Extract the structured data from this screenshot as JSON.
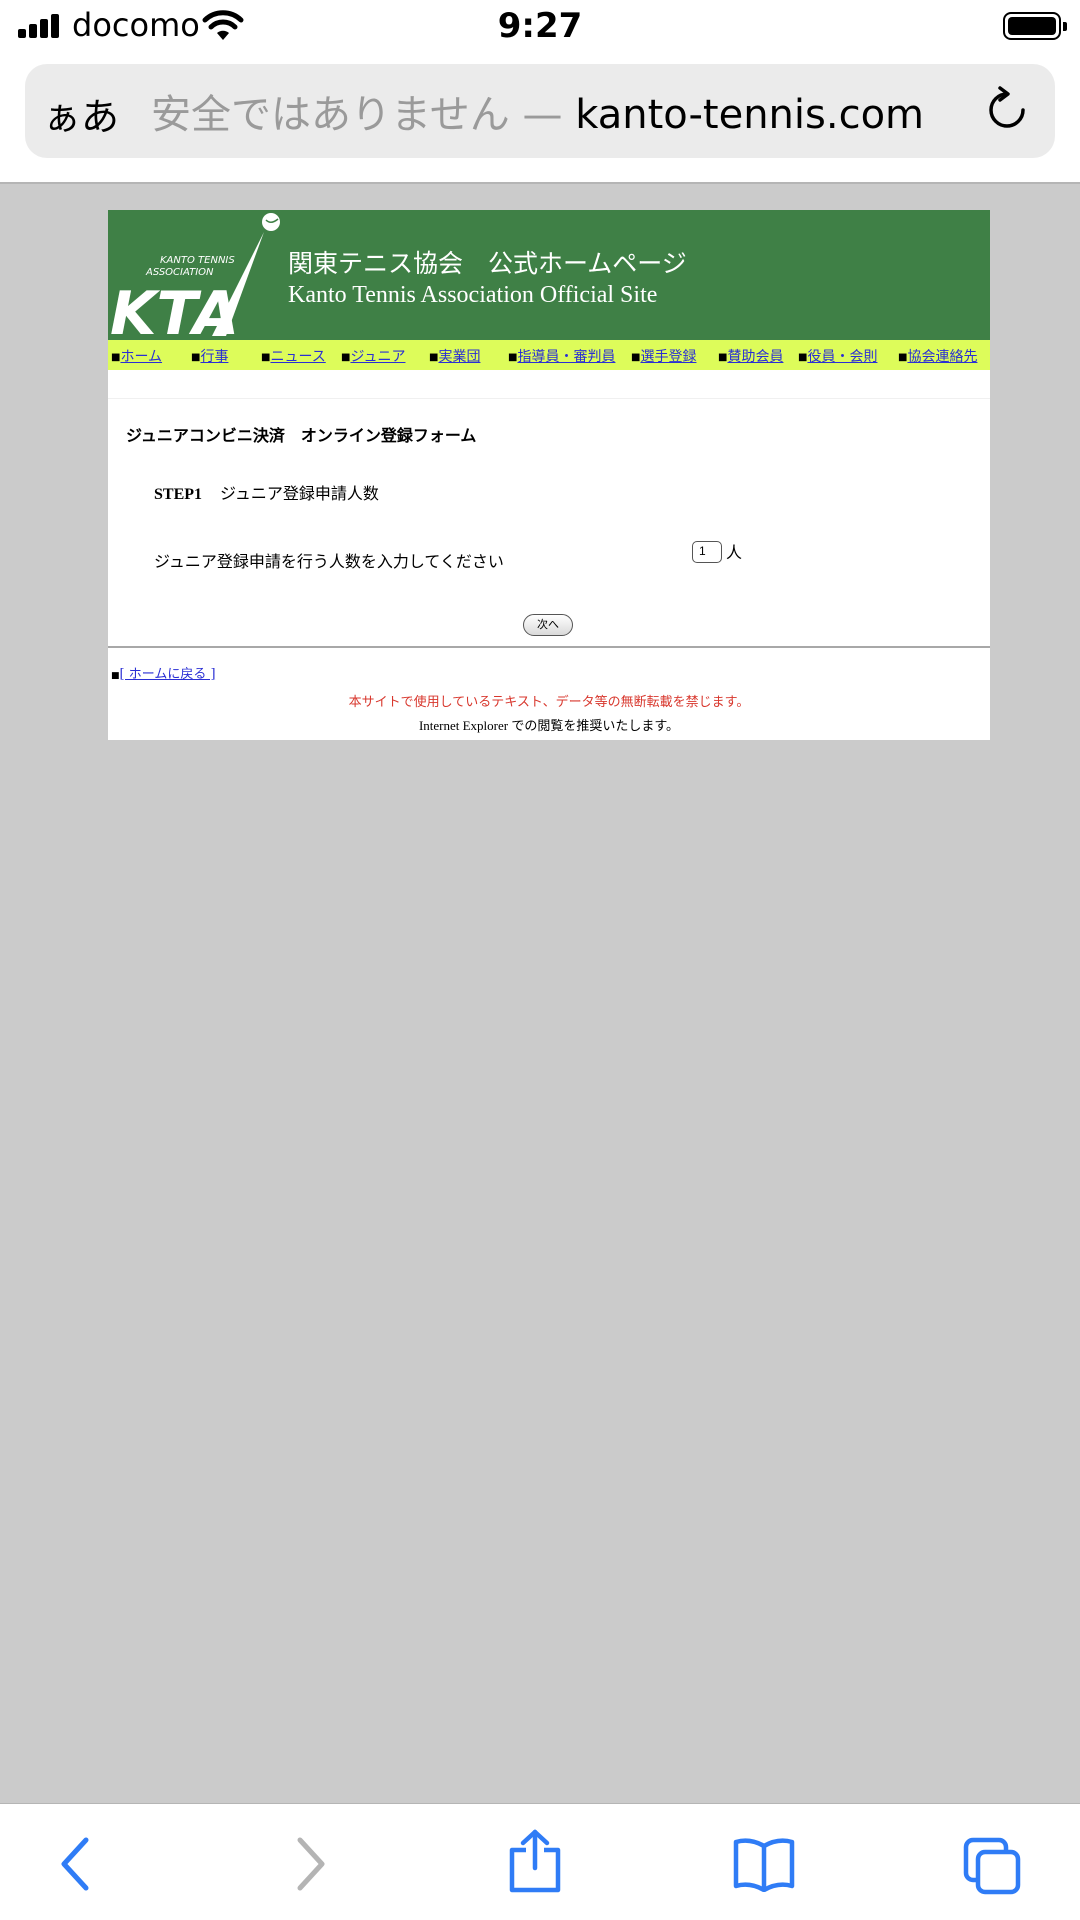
{
  "status_bar": {
    "carrier": "docomo",
    "time": "9:27"
  },
  "browser": {
    "text_size_button": "ぁあ",
    "url_warning": "安全ではありません",
    "url_dash": "—",
    "url_host": "kanto-tennis.com"
  },
  "site": {
    "logo_small_text": "KANTO TENNIS ASSOCIATION",
    "logo_letters": "KTA",
    "title_ja": "関東テニス協会　公式ホームページ",
    "title_en": "Kanto Tennis Association Official Site"
  },
  "menu": {
    "bullet": "■",
    "items": [
      {
        "label": "ホーム"
      },
      {
        "label": "行事"
      },
      {
        "label": "ニュース"
      },
      {
        "label": "ジュニア"
      },
      {
        "label": "実業団"
      },
      {
        "label": "指導員・審判員"
      },
      {
        "label": "選手登録"
      },
      {
        "label": "賛助会員"
      },
      {
        "label": "役員・会則"
      },
      {
        "label": "協会連絡先"
      }
    ]
  },
  "form": {
    "title": "ジュニアコンビニ決済　オンライン登録フォーム",
    "step_label": "STEP1",
    "step_title": "ジュニア登録申請人数",
    "prompt": "ジュニア登録申請を行う人数を入力してください",
    "count_value": "1",
    "unit": "人",
    "next_button": "次へ"
  },
  "footer": {
    "home_link_bullet": "■",
    "home_link": "[ ホームに戻る ]",
    "copyright": "本サイトで使用しているテキスト、データ等の無断転載を禁じます。",
    "browser_note": "Internet Explorer での閲覧を推奨いたします。"
  },
  "colors": {
    "banner_green": "#3f8046",
    "menu_lime": "#ddfc5a",
    "link_blue": "#2a2fd4",
    "notice_red": "#d8372d",
    "ios_blue": "#2f7cf6"
  },
  "icons": {
    "back": "chevron-left-icon",
    "forward": "chevron-right-icon",
    "share": "share-icon",
    "bookmarks": "book-icon",
    "tabs": "tabs-icon",
    "reload": "reload-icon"
  }
}
